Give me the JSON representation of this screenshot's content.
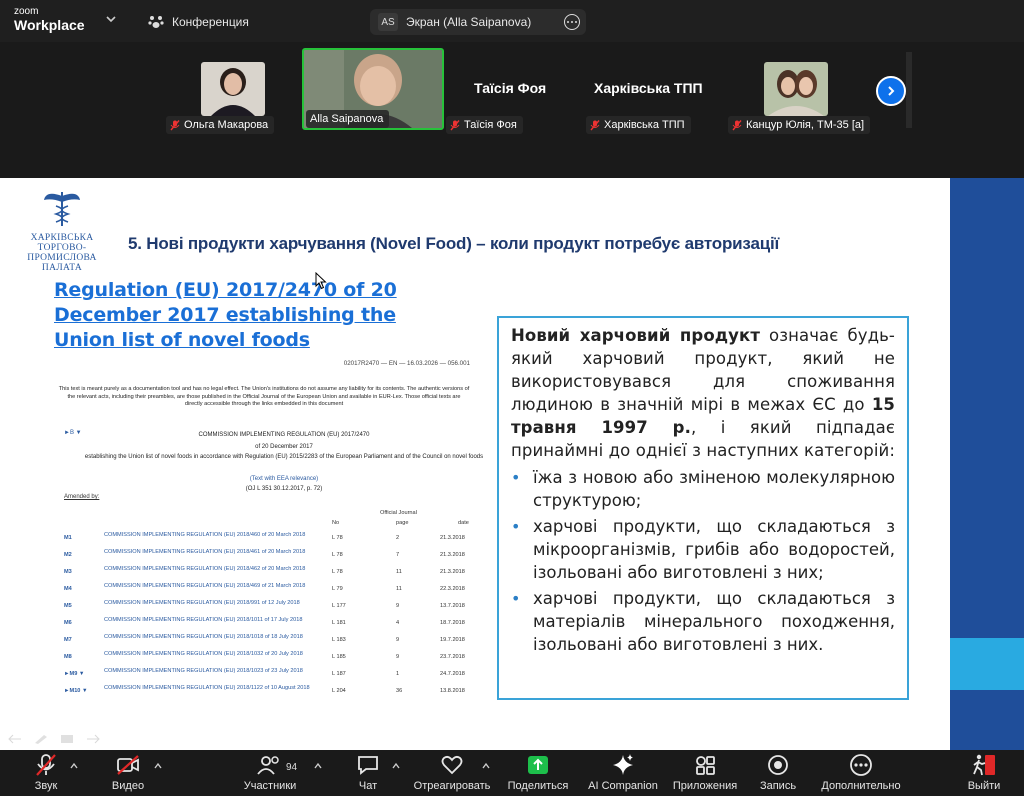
{
  "topbar": {
    "brand_line1": "zoom",
    "brand_line2": "Workplace",
    "tab_conference": "Конференция",
    "screen_badge": "AS",
    "tab_screen": "Экран (Alla Saipanova)"
  },
  "participants": [
    {
      "name": "Ольга Макарова",
      "muted": true
    },
    {
      "name": "Alla Saipanova",
      "muted": false,
      "active_speaker": true
    },
    {
      "display": "Таїсія Фоя",
      "name": "Таїсія Фоя",
      "muted": true
    },
    {
      "display": "Харківська ТПП",
      "name": "Харківська ТПП",
      "muted": true
    },
    {
      "name": "Канцур Юлія, ТМ-35 [а]",
      "muted": true
    }
  ],
  "slide": {
    "logo_lines": [
      "ХАРКІВСЬКА",
      "ТОРГОВО-ПРОМИСЛОВА",
      "ПАЛАТА"
    ],
    "title": "5. Нові продукти харчування (Novel Food) – коли продукт потребує авторизації",
    "regulation_link": "Regulation (EU) 2017/2470 of 20 December 2017 establishing the Union list of novel foods",
    "document": {
      "id_line": "02017R2470 — EN — 16.03.2026 — 056.001",
      "note": "This text is meant purely as a documentation tool and has no legal effect. The Union's institutions do not assume any liability for its contents. The authentic versions of the relevant acts, including their preambles, are those published in the Official Journal of the European Union and available in EUR-Lex. Those official texts are directly accessible through the links embedded in this document",
      "marker": "►B ▼",
      "heading": "COMMISSION IMPLEMENTING REGULATION (EU) 2017/2470",
      "date": "of 20 December 2017",
      "subject": "establishing the Union list of novel foods in accordance with Regulation (EU) 2015/2283 of the European Parliament and of the Council on novel foods",
      "eea": "(Text with EEA relevance)",
      "oj_ref": "(OJ L 351 30.12.2017, p. 72)",
      "amended_by": "Amended by:",
      "oj_header": "Official Journal",
      "col_no": "No",
      "col_page": "page",
      "col_date": "date",
      "amendments": [
        {
          "m": "M1",
          "title": "COMMISSION IMPLEMENTING REGULATION (EU) 2018/460 of 20 March 2018",
          "no": "L 78",
          "page": "2",
          "date": "21.3.2018"
        },
        {
          "m": "M2",
          "title": "COMMISSION IMPLEMENTING REGULATION (EU) 2018/461 of 20 March 2018",
          "no": "L 78",
          "page": "7",
          "date": "21.3.2018"
        },
        {
          "m": "M3",
          "title": "COMMISSION IMPLEMENTING REGULATION (EU) 2018/462 of 20 March 2018",
          "no": "L 78",
          "page": "11",
          "date": "21.3.2018"
        },
        {
          "m": "M4",
          "title": "COMMISSION IMPLEMENTING REGULATION (EU) 2018/469 of 21 March 2018",
          "no": "L 79",
          "page": "11",
          "date": "22.3.2018"
        },
        {
          "m": "M5",
          "title": "COMMISSION IMPLEMENTING REGULATION (EU) 2018/991 of 12 July 2018",
          "no": "L 177",
          "page": "9",
          "date": "13.7.2018"
        },
        {
          "m": "M6",
          "title": "COMMISSION IMPLEMENTING REGULATION (EU) 2018/1011 of 17 July 2018",
          "no": "L 181",
          "page": "4",
          "date": "18.7.2018"
        },
        {
          "m": "M7",
          "title": "COMMISSION IMPLEMENTING REGULATION (EU) 2018/1018 of 18 July 2018",
          "no": "L 183",
          "page": "9",
          "date": "19.7.2018"
        },
        {
          "m": "M8",
          "title": "COMMISSION IMPLEMENTING REGULATION (EU) 2018/1032 of 20 July 2018",
          "no": "L 185",
          "page": "9",
          "date": "23.7.2018"
        },
        {
          "m": "►M9 ▼",
          "title": "COMMISSION IMPLEMENTING REGULATION (EU) 2018/1023 of 23 July 2018",
          "no": "L 187",
          "page": "1",
          "date": "24.7.2018"
        },
        {
          "m": "►M10 ▼",
          "title": "COMMISSION IMPLEMENTING REGULATION (EU) 2018/1122 of 10 August 2018",
          "no": "L 204",
          "page": "36",
          "date": "13.8.2018"
        }
      ]
    },
    "definition": {
      "term": "Новий харчовий продукт",
      "text_a": " означає будь-який харчовий продукт, який не використовувався для споживання людиною в значній мірі в межах ЄС до ",
      "date_bold": "15 травня 1997 р.",
      "text_b": ", і який підпадає принаймні до однієї з наступних категорій:",
      "bullets": [
        "їжа з новою або зміненою молекулярною структурою;",
        "харчові продукти, що складаються з мікроорганізмів, грибів або водоростей, ізольовані або виготовлені з них;",
        "харчові продукти, що складаються з матеріалів мінерального походження, ізольовані або виготовлені з них."
      ]
    }
  },
  "toolbar": {
    "audio": "Звук",
    "video": "Видео",
    "participants": "Участники",
    "participants_count": "94",
    "chat": "Чат",
    "react": "Отреагировать",
    "share": "Поделиться",
    "ai": "AI Companion",
    "apps": "Приложения",
    "record": "Запись",
    "more": "Дополнительно",
    "leave": "Выйти"
  },
  "colors": {
    "accent_blue": "#0e71eb",
    "share_green": "#1dbf4b",
    "leave_red": "#e02828",
    "slide_navy": "#1f4e9a",
    "slide_light_blue": "#29aae1",
    "active_speaker_border": "#27c23a"
  }
}
